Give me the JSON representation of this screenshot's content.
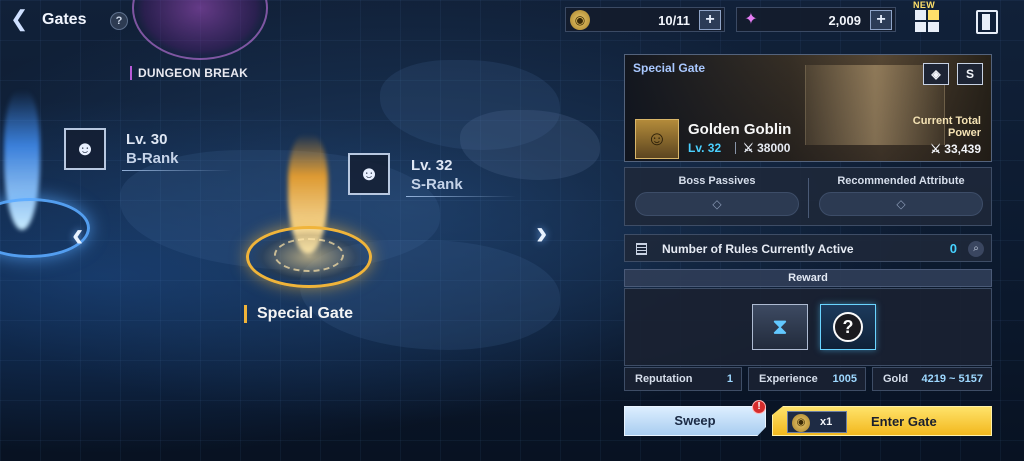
{
  "header": {
    "back_icon": "back-arrow-icon",
    "title": "Gates",
    "help_label": "?"
  },
  "dungeon_break": {
    "label": "DUNGEON BREAK",
    "icons": [
      "clock-icon",
      "gift-icon"
    ]
  },
  "map": {
    "gates": [
      {
        "level": "Lv. 30",
        "rank": "B-Rank",
        "beam_color": "#4a9bff",
        "emblem_icon": "monster-head-icon"
      },
      {
        "level": "Lv. 32",
        "rank": "S-Rank",
        "emblem_icon": "monster-head-icon"
      }
    ],
    "special_gate_label": "Special Gate",
    "special_gate_color": "#f0b43a"
  },
  "resources": {
    "ticket": {
      "icon": "gate-ticket-icon",
      "value": "10/11",
      "add_label": "+"
    },
    "crystal": {
      "icon": "crystal-icon",
      "value": "2,009",
      "add_label": "+"
    },
    "new_badge": "NEW"
  },
  "panel": {
    "gate_title": "Special Gate",
    "corner_icons": [
      "element-icon",
      "S"
    ],
    "boss": {
      "name": "Golden Goblin",
      "level": "Lv. 32",
      "power": "38000",
      "portrait_icon": "goblin-portrait-icon"
    },
    "current_total_power": {
      "label": "Current Total Power",
      "value": "33,439"
    },
    "boss_passives": {
      "label": "Boss Passives",
      "value": "◇"
    },
    "recommended_attribute": {
      "label": "Recommended Attribute",
      "value": "◇"
    },
    "rules": {
      "label": "Number of Rules Currently Active",
      "count": "0",
      "info_icon": "info-icon"
    },
    "reward": {
      "title": "Reward",
      "items": [
        {
          "icon": "hourglass-icon"
        },
        {
          "icon": "mystery-reward-icon",
          "glyph": "?"
        }
      ]
    },
    "stats": [
      {
        "label": "Reputation",
        "value": "1"
      },
      {
        "label": "Experience",
        "value": "1005"
      },
      {
        "label": "Gold",
        "value": "4219 ~ 5157"
      }
    ],
    "sweep": {
      "label": "Sweep",
      "alert": "!"
    },
    "enter": {
      "cost": "x1",
      "label": "Enter Gate"
    }
  },
  "colors": {
    "accent_blue": "#46d2ff",
    "accent_gold": "#f2b81e",
    "dungeon_purple": "#b85ad8"
  }
}
